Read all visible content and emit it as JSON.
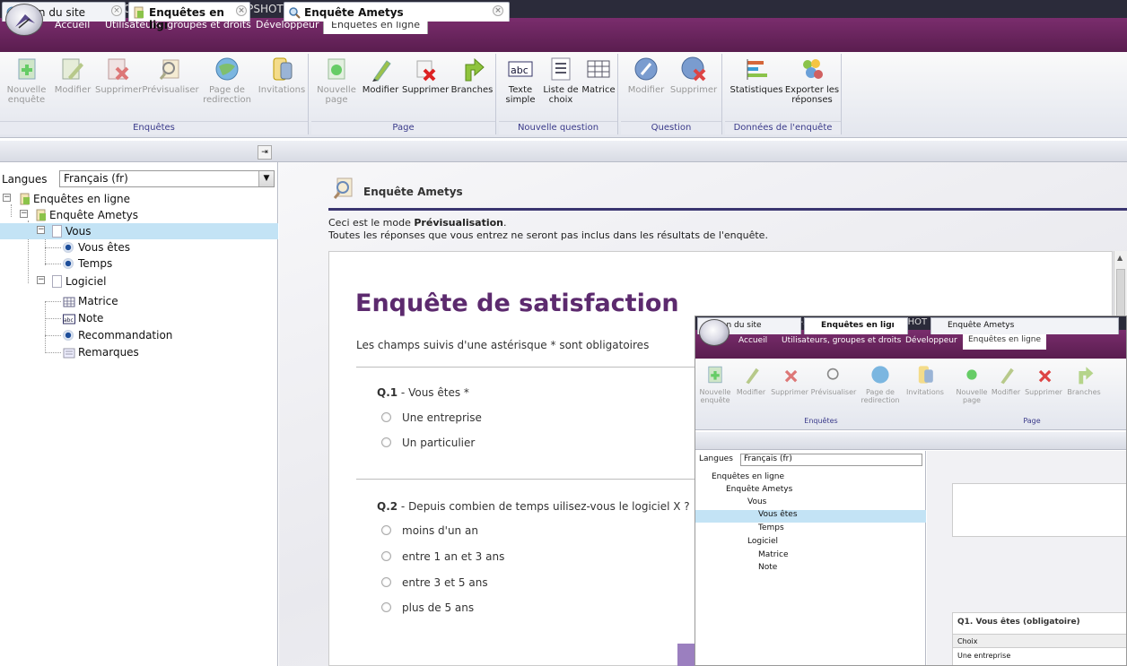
{
  "window": {
    "title": "Ametys 3.3.0-20120201-0423-SNAPSHOT (www)"
  },
  "menu": {
    "items": [
      "Accueil",
      "Utilisateurs, groupes et droits",
      "Développeur"
    ],
    "active_tab": "Enquêtes en ligne"
  },
  "ribbon": {
    "groups": {
      "enquetes": "Enquêtes",
      "page": "Page",
      "nouvelle_question": "Nouvelle question",
      "question": "Question",
      "donnees": "Données de l'enquête"
    },
    "buttons": {
      "nouvelle_enquete": "Nouvelle\nenquête",
      "modifier": "Modifier",
      "supprimer": "Supprimer",
      "previsualiser": "Prévisualiser",
      "page_redirection": "Page de\nredirection",
      "invitations": "Invitations",
      "nouvelle_page": "Nouvelle\npage",
      "page_modifier": "Modifier",
      "page_supprimer": "Supprimer",
      "branches": "Branches",
      "texte_simple": "Texte\nsimple",
      "liste_choix": "Liste de\nchoix",
      "matrice": "Matrice",
      "q_modifier": "Modifier",
      "q_supprimer": "Supprimer",
      "statistiques": "Statistiques",
      "exporter": "Exporter les\nréponses"
    }
  },
  "panel_tabs": {
    "plan": "Plan du site",
    "enquetes": "Enquêtes en ligı",
    "content": "Enquête Ametys"
  },
  "tree": {
    "lang_label": "Langues",
    "lang_value": "Français (fr)",
    "items": {
      "root": "Enquêtes en ligne",
      "survey": "Enquête Ametys",
      "page1": "Vous",
      "q1": "Vous êtes",
      "q2": "Temps",
      "page2": "Logiciel",
      "q3": "Matrice",
      "q4": "Note",
      "q5": "Recommandation",
      "q6": "Remarques"
    }
  },
  "content": {
    "header": "Enquête Ametys",
    "info_prefix": "Ceci est le mode ",
    "info_mode": "Prévisualisation",
    "info_suffix": ".",
    "info2": "Toutes les réponses que vous entrez ne seront pas inclus dans les résultats de l'enquête.",
    "survey_title": "Enquête de satisfaction",
    "required_note": "Les champs suivis d'une astérisque * sont obligatoires",
    "q1": {
      "num": "Q.1",
      "text": " - Vous êtes *",
      "options": [
        "Une entreprise",
        "Un particulier"
      ]
    },
    "q2": {
      "num": "Q.2",
      "text": " - Depuis combien de temps uilisez-vous le logiciel X ?",
      "options": [
        "moins d'un an",
        "entre 1 an et 3 ans",
        "entre 3 et 5 ans",
        "plus de 5 ans"
      ]
    }
  },
  "inset": {
    "title": "Ametys 3.3.0-20120201-0423-SNAPSHOT (www)",
    "menu": [
      "Accueil",
      "Utilisateurs, groupes et droits",
      "Développeur"
    ],
    "active_tab": "Enquêtes en ligne",
    "buttons": [
      "Nouvelle\nenquête",
      "Modifier",
      "Supprimer",
      "Prévisualiser",
      "Page de\nredirection",
      "Invitations",
      "Nouvelle\npage",
      "Modifier",
      "Supprimer",
      "Branches"
    ],
    "group_enquetes": "Enquêtes",
    "group_page": "Page",
    "tab_plan": "Plan du site",
    "tab_enquetes": "Enquêtes en ligı",
    "tab_content": "Enquête Ametys",
    "lang_label": "Langues",
    "lang_value": "Français (fr)",
    "tree": [
      "Enquêtes en ligne",
      "Enquête Ametys",
      "Vous",
      "Vous êtes",
      "Temps",
      "Logiciel",
      "Matrice",
      "Note"
    ],
    "question_header": "Q1. Vous êtes (obligatoire)",
    "col_header": "Choix",
    "cell": "Une entreprise"
  },
  "colors": {
    "accent": "#5c2a6e",
    "menubar": "#6b2660",
    "selection": "#c3e3f5"
  }
}
